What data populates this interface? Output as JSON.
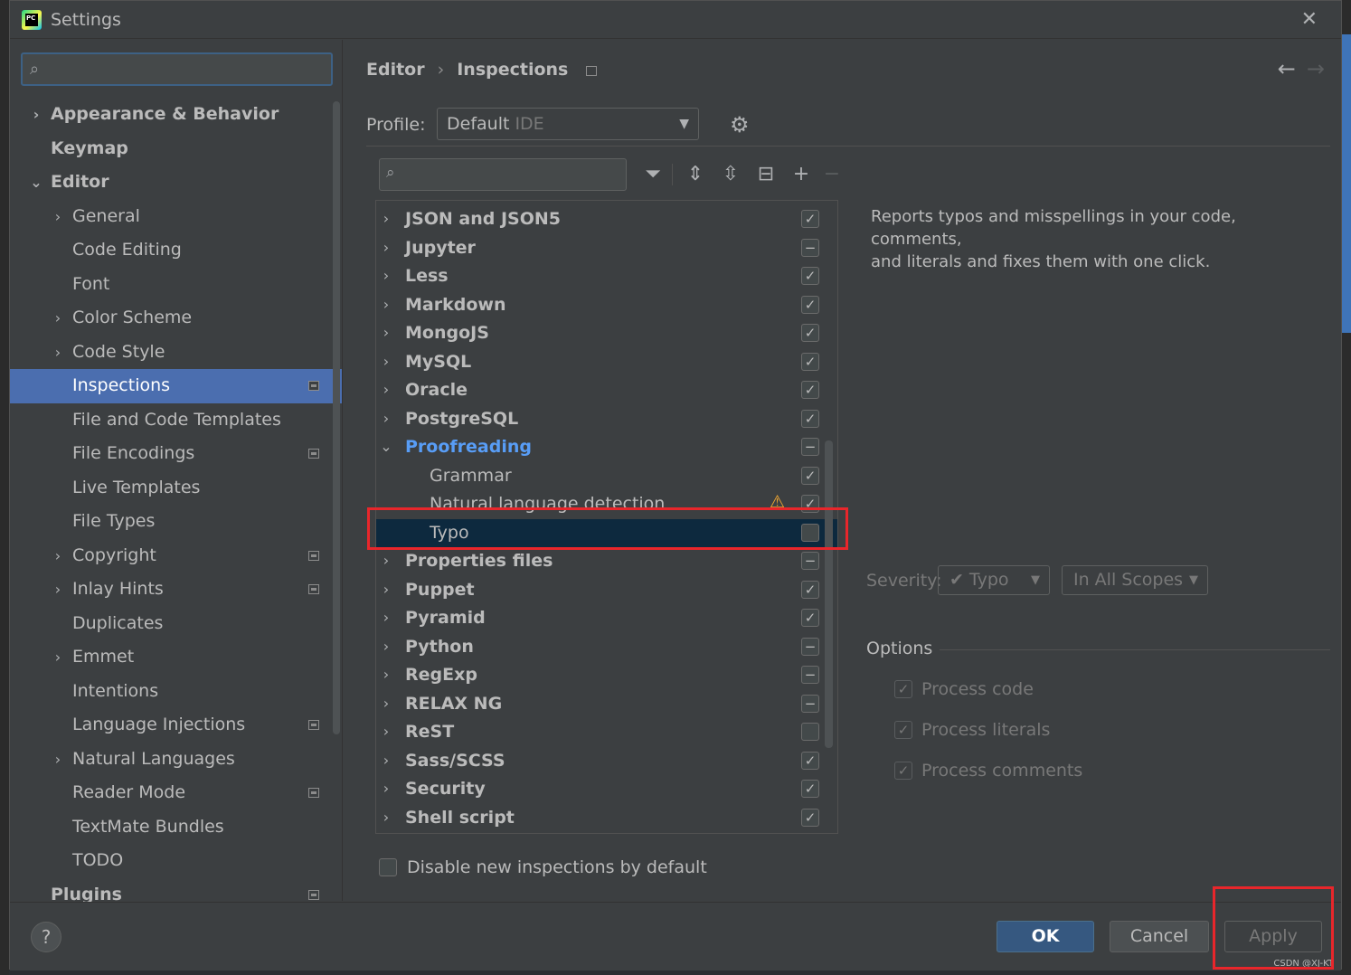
{
  "window": {
    "title": "Settings",
    "close_glyph": "✕"
  },
  "sidebar": {
    "search_placeholder": "",
    "items": [
      {
        "label": "Appearance & Behavior",
        "arrow": "›",
        "bold": true,
        "level": 0,
        "proj": false
      },
      {
        "label": "Keymap",
        "arrow": "",
        "bold": true,
        "level": 0,
        "proj": false
      },
      {
        "label": "Editor",
        "arrow": "⌄",
        "bold": true,
        "level": 0,
        "proj": false
      },
      {
        "label": "General",
        "arrow": "›",
        "bold": false,
        "level": 1,
        "proj": false
      },
      {
        "label": "Code Editing",
        "arrow": "",
        "bold": false,
        "level": 1,
        "proj": false
      },
      {
        "label": "Font",
        "arrow": "",
        "bold": false,
        "level": 1,
        "proj": false
      },
      {
        "label": "Color Scheme",
        "arrow": "›",
        "bold": false,
        "level": 1,
        "proj": false
      },
      {
        "label": "Code Style",
        "arrow": "›",
        "bold": false,
        "level": 1,
        "proj": false
      },
      {
        "label": "Inspections",
        "arrow": "",
        "bold": false,
        "level": 1,
        "proj": true,
        "selected": true
      },
      {
        "label": "File and Code Templates",
        "arrow": "",
        "bold": false,
        "level": 1,
        "proj": false
      },
      {
        "label": "File Encodings",
        "arrow": "",
        "bold": false,
        "level": 1,
        "proj": true
      },
      {
        "label": "Live Templates",
        "arrow": "",
        "bold": false,
        "level": 1,
        "proj": false
      },
      {
        "label": "File Types",
        "arrow": "",
        "bold": false,
        "level": 1,
        "proj": false
      },
      {
        "label": "Copyright",
        "arrow": "›",
        "bold": false,
        "level": 1,
        "proj": true
      },
      {
        "label": "Inlay Hints",
        "arrow": "›",
        "bold": false,
        "level": 1,
        "proj": true
      },
      {
        "label": "Duplicates",
        "arrow": "",
        "bold": false,
        "level": 1,
        "proj": false
      },
      {
        "label": "Emmet",
        "arrow": "›",
        "bold": false,
        "level": 1,
        "proj": false
      },
      {
        "label": "Intentions",
        "arrow": "",
        "bold": false,
        "level": 1,
        "proj": false
      },
      {
        "label": "Language Injections",
        "arrow": "",
        "bold": false,
        "level": 1,
        "proj": true
      },
      {
        "label": "Natural Languages",
        "arrow": "›",
        "bold": false,
        "level": 1,
        "proj": false
      },
      {
        "label": "Reader Mode",
        "arrow": "",
        "bold": false,
        "level": 1,
        "proj": true
      },
      {
        "label": "TextMate Bundles",
        "arrow": "",
        "bold": false,
        "level": 1,
        "proj": false
      },
      {
        "label": "TODO",
        "arrow": "",
        "bold": false,
        "level": 1,
        "proj": false
      },
      {
        "label": "Plugins",
        "arrow": "",
        "bold": true,
        "level": 0,
        "proj": true
      }
    ]
  },
  "breadcrumb": {
    "part1": "Editor",
    "separator": "›",
    "part2": "Inspections"
  },
  "nav": {
    "back": "←",
    "forward": "→"
  },
  "profile": {
    "label": "Profile:",
    "value": "Default",
    "scope": "IDE",
    "caret": "▼"
  },
  "icons": {
    "gear": "⚙",
    "search": "⌕",
    "filter": "⏷",
    "expand_all": "⇕",
    "collapse_all": "⇳",
    "toggle": "⊟",
    "add": "+",
    "remove": "−"
  },
  "inspections": [
    {
      "label": "JSON and JSON5",
      "arrow": "›",
      "style": "bold",
      "indent": 0,
      "check": "✓"
    },
    {
      "label": "Jupyter",
      "arrow": "›",
      "style": "bold",
      "indent": 0,
      "check": "−"
    },
    {
      "label": "Less",
      "arrow": "›",
      "style": "bold",
      "indent": 0,
      "check": "✓"
    },
    {
      "label": "Markdown",
      "arrow": "›",
      "style": "bold",
      "indent": 0,
      "check": "✓"
    },
    {
      "label": "MongoJS",
      "arrow": "›",
      "style": "bold",
      "indent": 0,
      "check": "✓"
    },
    {
      "label": "MySQL",
      "arrow": "›",
      "style": "bold",
      "indent": 0,
      "check": "✓"
    },
    {
      "label": "Oracle",
      "arrow": "›",
      "style": "bold",
      "indent": 0,
      "check": "✓"
    },
    {
      "label": "PostgreSQL",
      "arrow": "›",
      "style": "bold",
      "indent": 0,
      "check": "✓"
    },
    {
      "label": "Proofreading",
      "arrow": "⌄",
      "style": "link",
      "indent": 0,
      "check": "−"
    },
    {
      "label": "Grammar",
      "arrow": "",
      "style": "normal",
      "indent": 1,
      "check": "✓"
    },
    {
      "label": "Natural language detection",
      "arrow": "",
      "style": "normal",
      "indent": 1,
      "check": "✓",
      "warning": "⚠"
    },
    {
      "label": "Typo",
      "arrow": "",
      "style": "normal",
      "indent": 1,
      "check": "",
      "selected": true
    },
    {
      "label": "Properties files",
      "arrow": "›",
      "style": "bold",
      "indent": 0,
      "check": "−"
    },
    {
      "label": "Puppet",
      "arrow": "›",
      "style": "bold",
      "indent": 0,
      "check": "✓"
    },
    {
      "label": "Pyramid",
      "arrow": "›",
      "style": "bold",
      "indent": 0,
      "check": "✓"
    },
    {
      "label": "Python",
      "arrow": "›",
      "style": "bold",
      "indent": 0,
      "check": "−"
    },
    {
      "label": "RegExp",
      "arrow": "›",
      "style": "bold",
      "indent": 0,
      "check": "−"
    },
    {
      "label": "RELAX NG",
      "arrow": "›",
      "style": "bold",
      "indent": 0,
      "check": "−"
    },
    {
      "label": "ReST",
      "arrow": "›",
      "style": "bold",
      "indent": 0,
      "check": ""
    },
    {
      "label": "Sass/SCSS",
      "arrow": "›",
      "style": "bold",
      "indent": 0,
      "check": "✓"
    },
    {
      "label": "Security",
      "arrow": "›",
      "style": "bold",
      "indent": 0,
      "check": "✓"
    },
    {
      "label": "Shell script",
      "arrow": "›",
      "style": "bold",
      "indent": 0,
      "check": "✓"
    }
  ],
  "description": {
    "line1": "Reports typos and misspellings in your code, comments,",
    "line2": "and literals and fixes them with one click."
  },
  "severity": {
    "label": "Severity:",
    "value": "Typo",
    "scope": "In All Scopes",
    "caret": "▼"
  },
  "options": {
    "label": "Options",
    "items": [
      {
        "label": "Process code",
        "check": "✓"
      },
      {
        "label": "Process literals",
        "check": "✓"
      },
      {
        "label": "Process comments",
        "check": "✓"
      }
    ]
  },
  "disable_new": {
    "label": "Disable new inspections by default",
    "check": ""
  },
  "footer": {
    "help": "?",
    "ok": "OK",
    "cancel": "Cancel",
    "apply": "Apply",
    "watermark": "CSDN @XJ-KT"
  },
  "colors": {
    "accent": "#4b6eaf",
    "link": "#589df6",
    "highlight_box": "#e8262b",
    "ok_button": "#365880"
  }
}
